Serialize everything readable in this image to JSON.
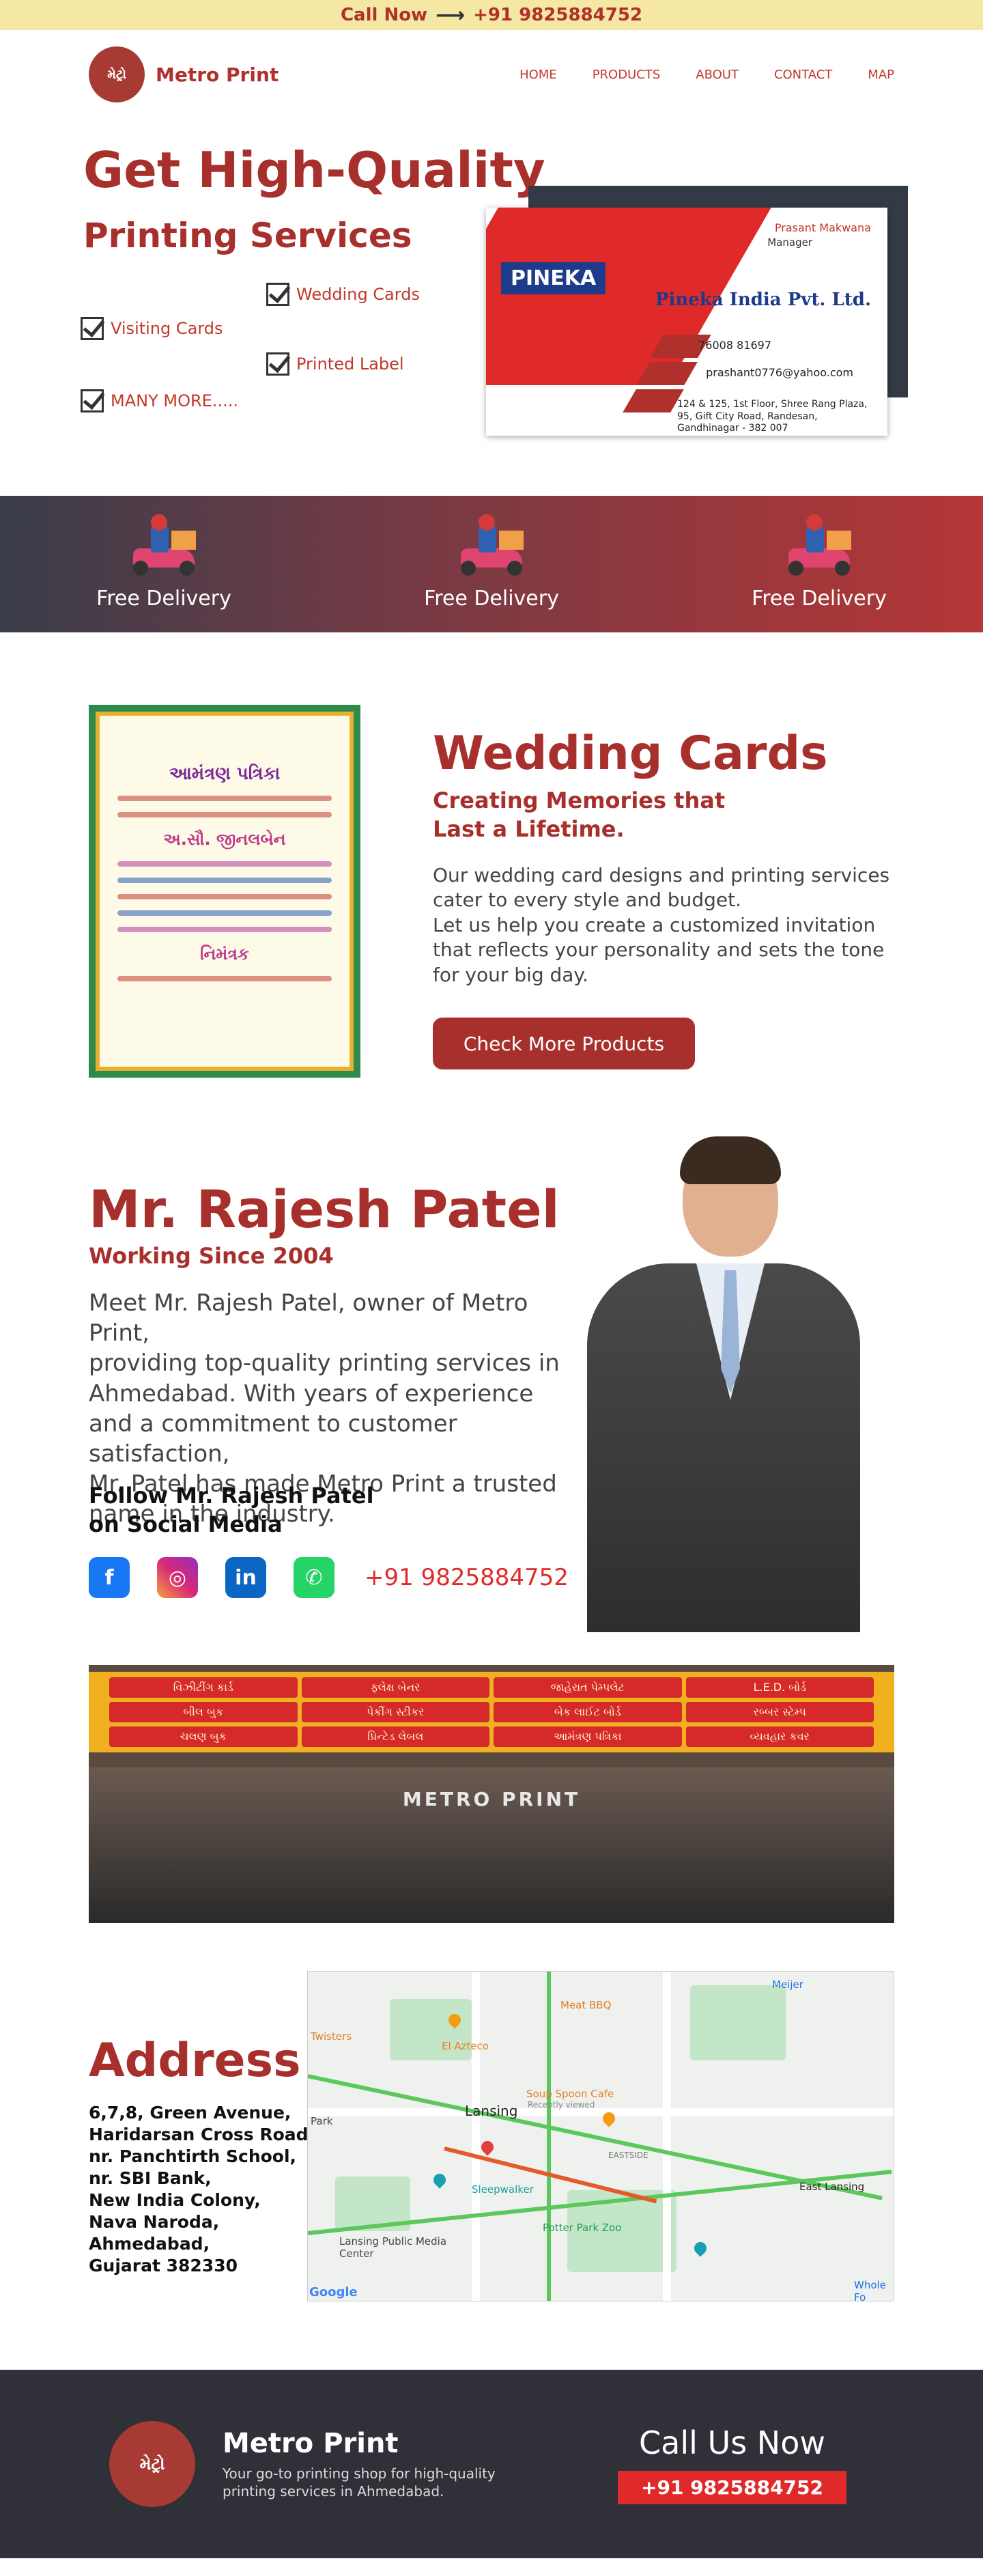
{
  "topbar": {
    "call_label": "Call Now",
    "arrow": "⟶",
    "phone": "+91 9825884752"
  },
  "brand": {
    "logo_text": "મેટ્રો",
    "name": "Metro Print"
  },
  "nav": {
    "items": [
      "HOME",
      "PRODUCTS",
      "ABOUT",
      "CONTACT",
      "MAP"
    ]
  },
  "hero": {
    "title": "Get High-Quality",
    "subtitle": "Printing Services",
    "checks": [
      "Wedding Cards",
      "Visiting Cards",
      "Printed Label",
      "MANY MORE....."
    ]
  },
  "business_card": {
    "logo": "PINEKA",
    "name": "Prasant Makwana",
    "role": "Manager",
    "company": "Pineka India Pvt. Ltd.",
    "phone": "76008 81697",
    "email": "prashant0776@yahoo.com",
    "address": "124 & 125, 1st Floor, Shree Rang Plaza,\n95, Gift City Road, Randesan,\nGandhinagar - 382 007"
  },
  "delivery": {
    "items": [
      "Free Delivery",
      "Free Delivery",
      "Free Delivery"
    ]
  },
  "wedding": {
    "invite_title": "આમંત્રણ પત્રિકા",
    "invite_name": "અ.સૌ. જીનલબેન",
    "invite_footer": "નિમંત્રક",
    "title": "Wedding Cards",
    "subtitle_line1": "Creating Memories that",
    "subtitle_line2": "Last a Lifetime.",
    "text_line1": "Our wedding card designs and printing services",
    "text_line2": "cater to every style and budget.",
    "text_line3": "Let us help you create a customized invitation",
    "text_line4": "that reflects your personality and sets the tone",
    "text_line5": "for your big day.",
    "button": "Check More Products"
  },
  "owner": {
    "title": "Mr. Rajesh Patel",
    "subtitle": "Working Since 2004",
    "text_line1": "Meet Mr. Rajesh Patel, owner of Metro Print,",
    "text_line2": "providing top-quality printing services in",
    "text_line3": "Ahmedabad. With years of experience",
    "text_line4": "and a commitment to customer satisfaction,",
    "text_line5": "Mr. Patel has made Metro Print a trusted",
    "text_line6": "name in the industry.",
    "follow_line1": "Follow Mr. Rajesh Patel",
    "follow_line2": "on Social Media",
    "socials": [
      {
        "icon": "facebook-icon",
        "glyph": "f"
      },
      {
        "icon": "instagram-icon",
        "glyph": "◎"
      },
      {
        "icon": "linkedin-icon",
        "glyph": "in"
      },
      {
        "icon": "whatsapp-icon",
        "glyph": "✆"
      }
    ],
    "phone": "+91 9825884752"
  },
  "shop": {
    "sign_items": [
      "વિઝીટીંગ કાર્ડ",
      "ફ્લેક્ષ બેનર",
      "જાહેરાત પેમ્પલેટ",
      "L.E.D. બોર્ડ",
      "બીલ બુક",
      "પેકીંગ સ્ટીકર",
      "બેક લાઈટ બોર્ડ",
      "રબ્બર સ્ટેમ્પ",
      "ચલણ બુક",
      "પ્રિન્ટેડ લેબલ",
      "આમંત્રણ પત્રિકા",
      "વ્યવહાર કવર"
    ],
    "front_text": "METRO PRINT"
  },
  "address": {
    "title": "Address",
    "lines": [
      "6,7,8, Green Avenue,",
      "Haridarsan Cross Road,",
      "nr. Panchtirth School,",
      "nr. SBI Bank,",
      "New India Colony,",
      "Nava Naroda,",
      "Ahmedabad,",
      "Gujarat 382330"
    ]
  },
  "map": {
    "labels": [
      "Meat BBQ",
      "Meijer",
      "Twisters",
      "El Azteco",
      "Lansing",
      "Soup Spoon Cafe",
      "Recently viewed",
      "Park",
      "EASTSIDE",
      "Sleepwalker",
      "East Lansing",
      "Potter Park Zoo",
      "Lansing Public Media Center",
      "Whole Fo",
      "Google"
    ]
  },
  "footer": {
    "logo_text": "મેટ્રો",
    "name": "Metro Print",
    "tagline": "Your go-to printing shop for high-quality printing services in Ahmedabad.",
    "call_title": "Call Us Now",
    "phone": "+91 9825884752"
  },
  "colors": {
    "accent": "#a8302c",
    "topbar": "#f4e8a4",
    "footer": "#2f3038",
    "phone_red": "#e02a2a"
  }
}
